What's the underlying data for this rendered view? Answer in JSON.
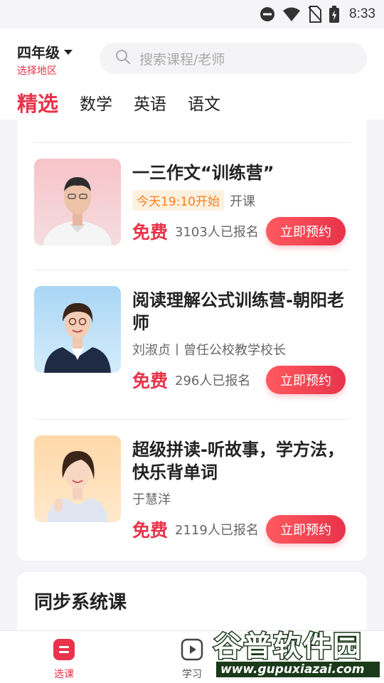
{
  "status_bar": {
    "time": "8:33"
  },
  "header": {
    "grade": "四年级",
    "region": "选择地区",
    "search_placeholder": "搜索课程/老师"
  },
  "tabs": [
    {
      "label": "精选",
      "active": true
    },
    {
      "label": "数学",
      "active": false
    },
    {
      "label": "英语",
      "active": false
    },
    {
      "label": "语文",
      "active": false
    }
  ],
  "courses": [
    {
      "title": "一三作文“训练营”",
      "start_badge": "今天19:10开始",
      "meta_text": "开课",
      "price": "免费",
      "enrolled": "3103人已报名",
      "button": "立即预约"
    },
    {
      "title": "阅读理解公式训练营-朝阳老师",
      "meta_text": "刘淑贞丨曾任公校教学校长",
      "price": "免费",
      "enrolled": "296人已报名",
      "button": "立即预约"
    },
    {
      "title": "超级拼读-听故事，学方法，快乐背单词",
      "meta_text": "于慧洋",
      "price": "免费",
      "enrolled": "2119人已报名",
      "button": "立即预约"
    }
  ],
  "section2": {
    "title": "同步系统课"
  },
  "bottom_nav": [
    {
      "label": "选课",
      "active": true,
      "icon": "select-course-icon"
    },
    {
      "label": "学习",
      "active": false,
      "icon": "play-icon"
    }
  ],
  "watermark": {
    "title": "谷普软件园",
    "url": "www.gupuxiazai.com"
  },
  "colors": {
    "accent": "#e8334a",
    "badge_text": "#ff7d1a",
    "badge_bg": "#fff1e0"
  }
}
